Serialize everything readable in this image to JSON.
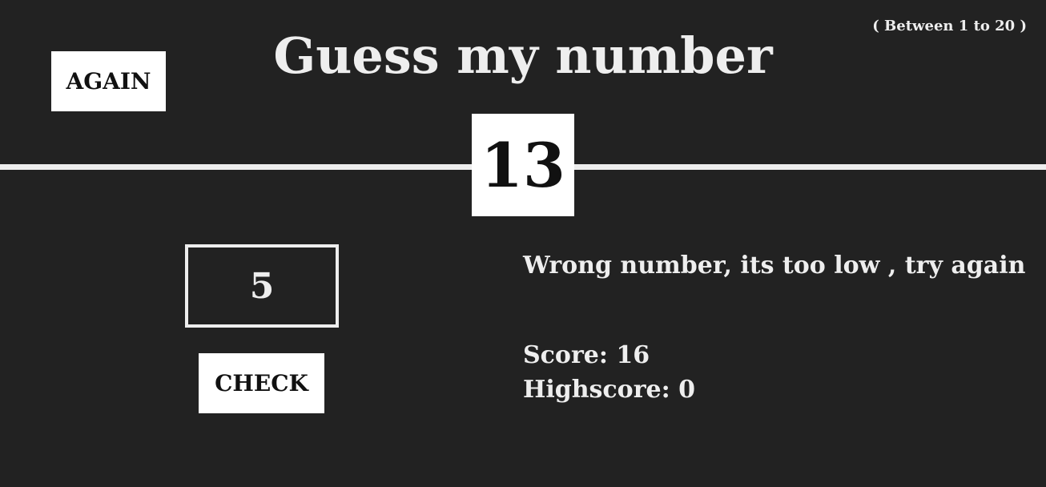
{
  "header": {
    "again_label": "AGAIN",
    "title": "Guess my number",
    "range_hint": "( Between 1 to 20 )"
  },
  "secret": {
    "value": "13"
  },
  "guess": {
    "value": "5"
  },
  "controls": {
    "check_label": "CHECK"
  },
  "status": {
    "message": "Wrong number, its too low , try again",
    "score_label": "Score:",
    "score_value": "16",
    "highscore_label": "Highscore:",
    "highscore_value": "0"
  },
  "colors": {
    "background": "#222222",
    "foreground": "#eeeeee",
    "box": "#ffffff",
    "box_text": "#111111"
  }
}
